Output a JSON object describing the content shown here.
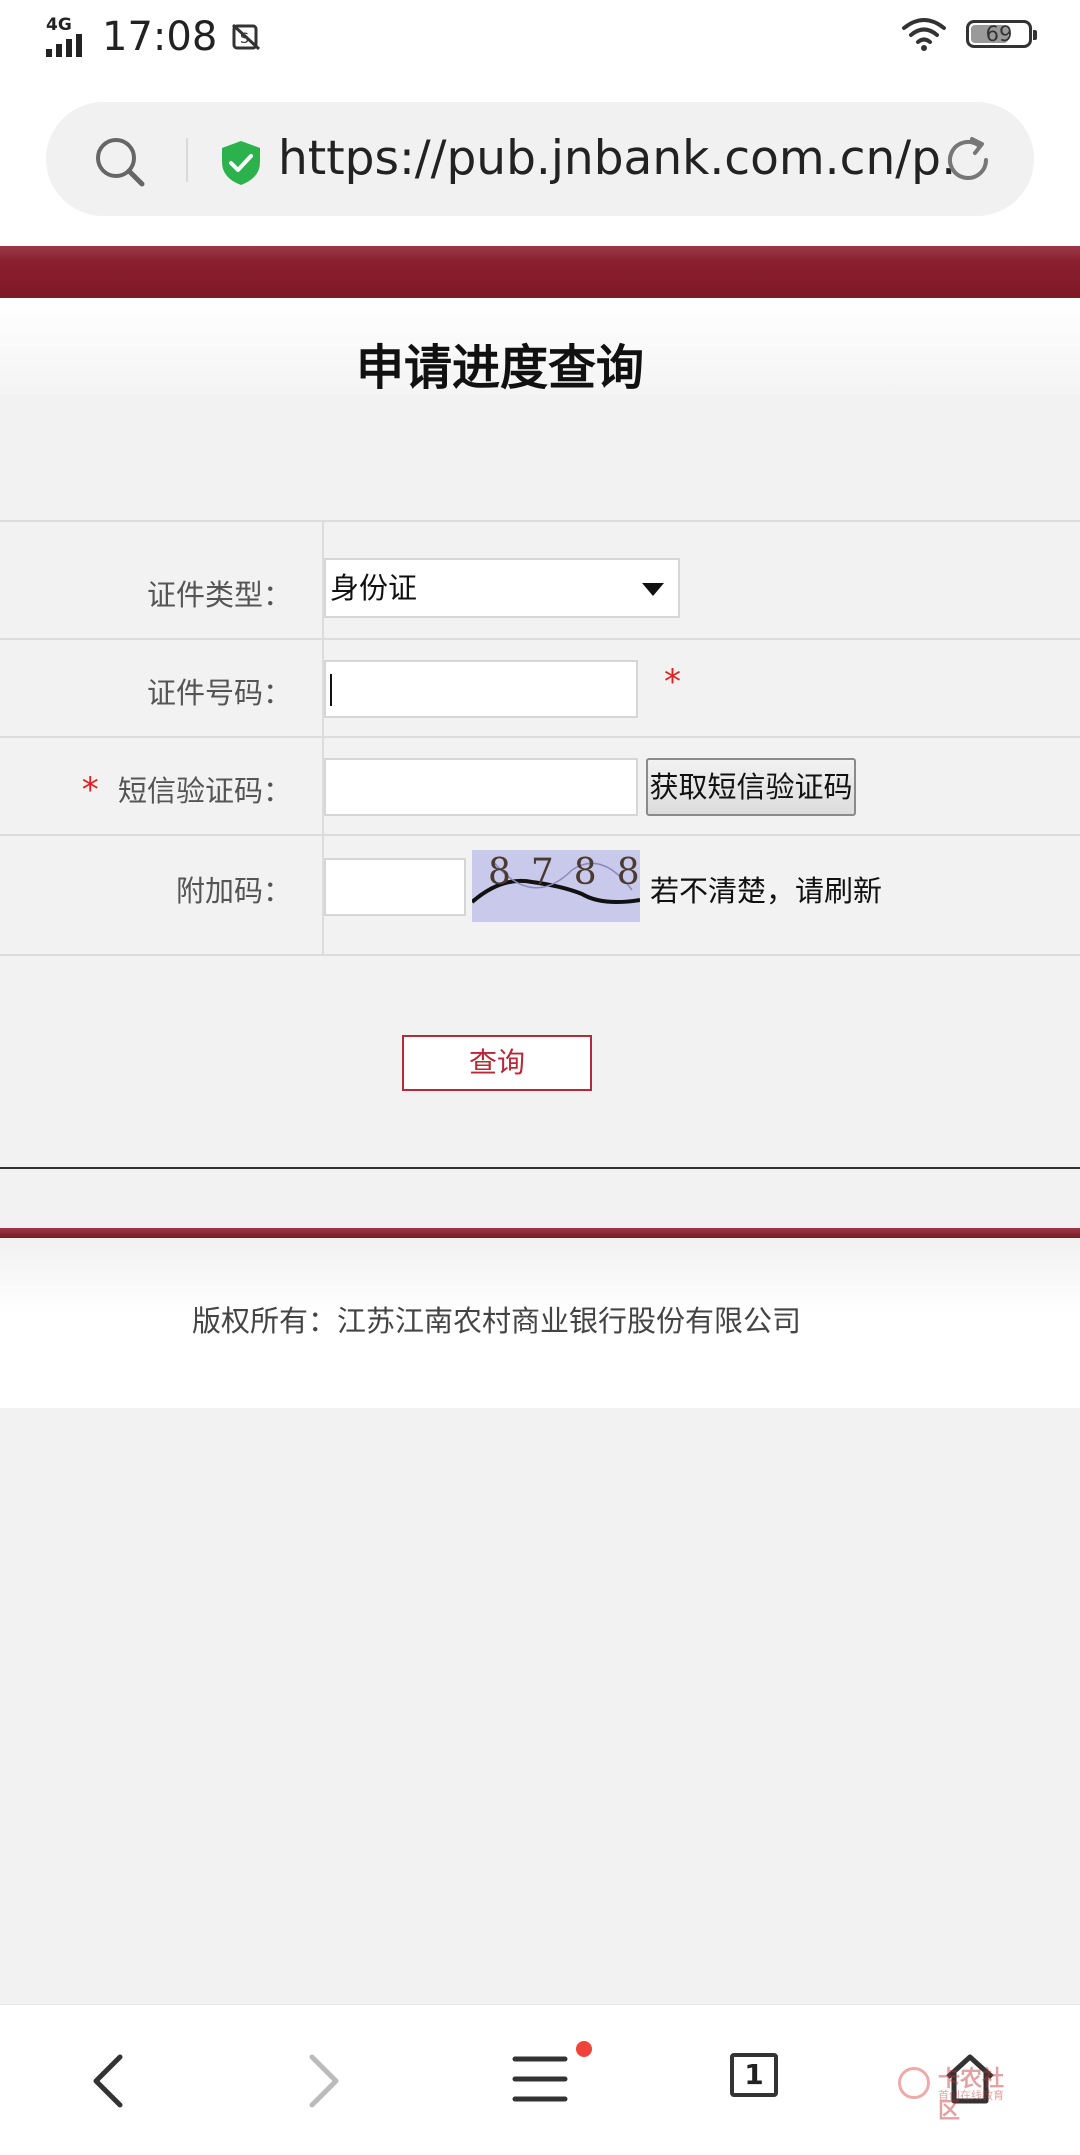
{
  "status_bar": {
    "network": "4G",
    "time": "17:08",
    "battery": "69"
  },
  "browser": {
    "url": "https://pub.jnbank.com.cn/p…"
  },
  "page": {
    "title": "申请进度查询",
    "form": {
      "id_type_label": "证件类型：",
      "id_type_value": "身份证",
      "id_number_label": "证件号码：",
      "required_mark": "*",
      "sms_code_label": "短信验证码：",
      "sms_button": "获取短信验证码",
      "captcha_label": "附加码：",
      "captcha_text": "8788",
      "captcha_hint": "若不清楚，请刷新",
      "query_button": "查询"
    },
    "footer": {
      "copyright": "版权所有：江苏江南农村商业银行股份有限公司"
    }
  },
  "bottom_nav": {
    "tab_count": "1"
  },
  "watermark": {
    "line1": "卡农社区",
    "line2": "首创在线教育"
  },
  "colors": {
    "brand": "#7e1826",
    "accent": "#b52a37",
    "required": "#d22222"
  }
}
